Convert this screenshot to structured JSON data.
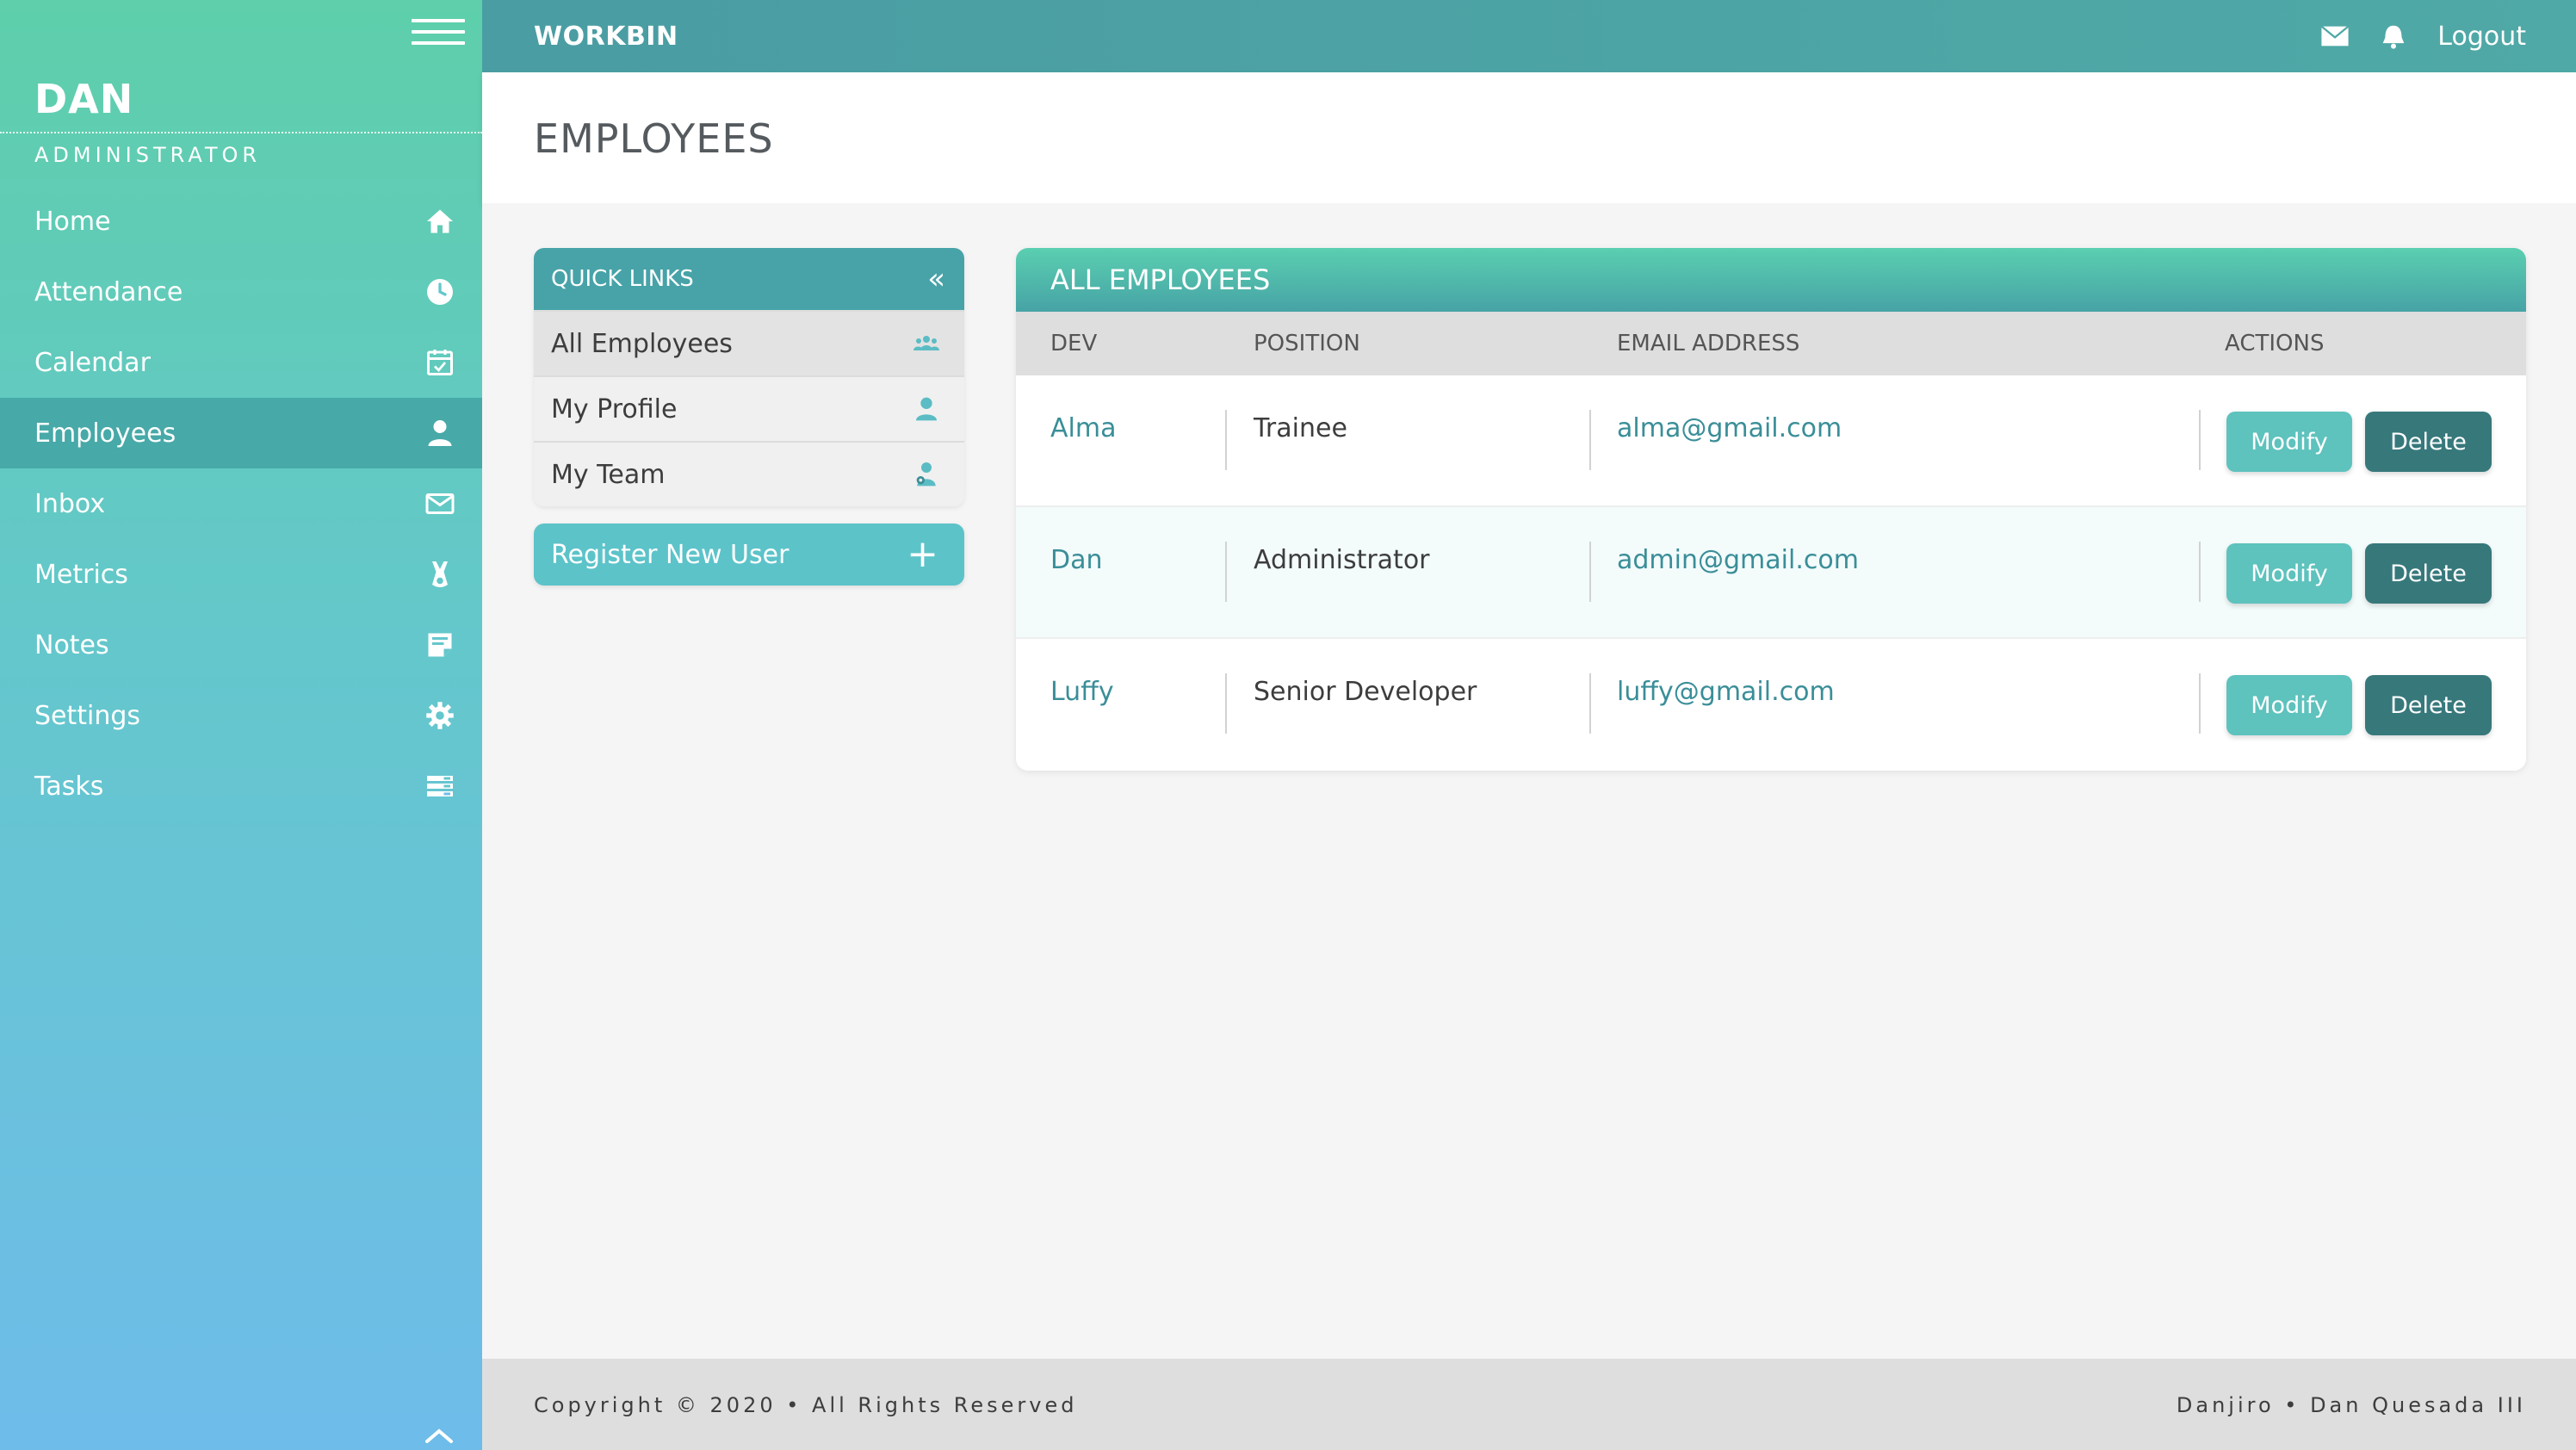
{
  "sidebar": {
    "user_name": "DAN",
    "user_role": "ADMINISTRATOR",
    "items": [
      {
        "label": "Home",
        "icon": "home-icon"
      },
      {
        "label": "Attendance",
        "icon": "clock-icon"
      },
      {
        "label": "Calendar",
        "icon": "calendar-icon"
      },
      {
        "label": "Employees",
        "icon": "user-icon",
        "active": true
      },
      {
        "label": "Inbox",
        "icon": "envelope-icon"
      },
      {
        "label": "Metrics",
        "icon": "flask-icon"
      },
      {
        "label": "Notes",
        "icon": "note-icon"
      },
      {
        "label": "Settings",
        "icon": "gear-icon"
      },
      {
        "label": "Tasks",
        "icon": "tasks-icon"
      }
    ]
  },
  "topbar": {
    "brand": "WORKBIN",
    "logout_label": "Logout"
  },
  "page": {
    "title": "EMPLOYEES"
  },
  "quick_links": {
    "title": "QUICK LINKS",
    "collapse_glyph": "«",
    "items": [
      {
        "label": "All Employees",
        "icon": "group-icon"
      },
      {
        "label": "My Profile",
        "icon": "user-icon"
      },
      {
        "label": "My Team",
        "icon": "team-icon"
      }
    ],
    "register_label": "Register New User",
    "register_glyph": "+"
  },
  "employees": {
    "title": "ALL EMPLOYEES",
    "columns": [
      "DEV",
      "POSITION",
      "EMAIL ADDRESS",
      "ACTIONS"
    ],
    "rows": [
      {
        "dev": "Alma",
        "position": "Trainee",
        "email": "alma@gmail.com"
      },
      {
        "dev": "Dan",
        "position": "Administrator",
        "email": "admin@gmail.com"
      },
      {
        "dev": "Luffy",
        "position": "Senior Developer",
        "email": "luffy@gmail.com"
      }
    ],
    "modify_label": "Modify",
    "delete_label": "Delete"
  },
  "footer": {
    "left": "Copyright © 2020 • All Rights Reserved",
    "right": "Danjiro • Dan Quesada III"
  },
  "colors": {
    "accent": "#47a9a8",
    "delete": "#37787b",
    "modify": "#5ec2bd"
  }
}
